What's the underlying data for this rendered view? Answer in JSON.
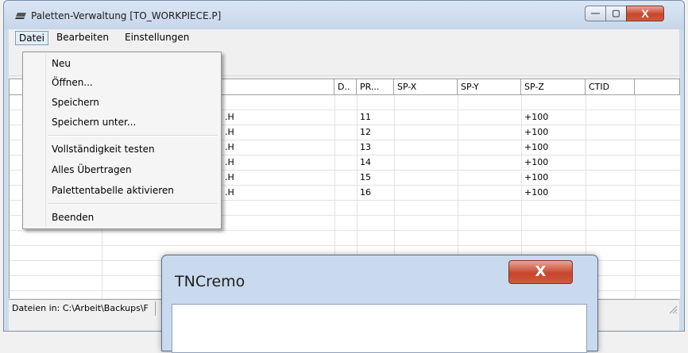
{
  "window": {
    "title": "Paletten-Verwaltung [TO_WORKPIECE.P]",
    "controls": {
      "minimize": "—",
      "maximize": "▢",
      "close": "X"
    }
  },
  "menubar": {
    "datei": "Datei",
    "bearbeiten": "Bearbeiten",
    "einstellungen": "Einstellungen"
  },
  "datei_menu": {
    "items": [
      "Neu",
      "Öffnen...",
      "Speichern",
      "Speichern unter...",
      "Vollständigkeit testen",
      "Alles Übertragen",
      "Palettentabelle aktivieren",
      "Beenden"
    ]
  },
  "table": {
    "headers": {
      "d": "D..",
      "pr": "PR...",
      "spx": "SP-X",
      "spy": "SP-Y",
      "spz": "SP-Z",
      "ctid": "CTID"
    },
    "rows": [
      {
        "name_suffix": ".H",
        "pr": "11",
        "spz": "+100"
      },
      {
        "name_suffix": ".H",
        "pr": "12",
        "spz": "+100"
      },
      {
        "name_suffix": ".H",
        "pr": "13",
        "spz": "+100"
      },
      {
        "name_suffix": ".H",
        "pr": "14",
        "spz": "+100"
      },
      {
        "name_suffix": ".H",
        "pr": "15",
        "spz": "+100"
      },
      {
        "name_suffix": ".H",
        "pr": "16",
        "spz": "+100"
      }
    ]
  },
  "statusbar": {
    "text": "Dateien in: C:\\Arbeit\\Backups\\F"
  },
  "dialog": {
    "title": "TNCremo",
    "close": "X"
  }
}
